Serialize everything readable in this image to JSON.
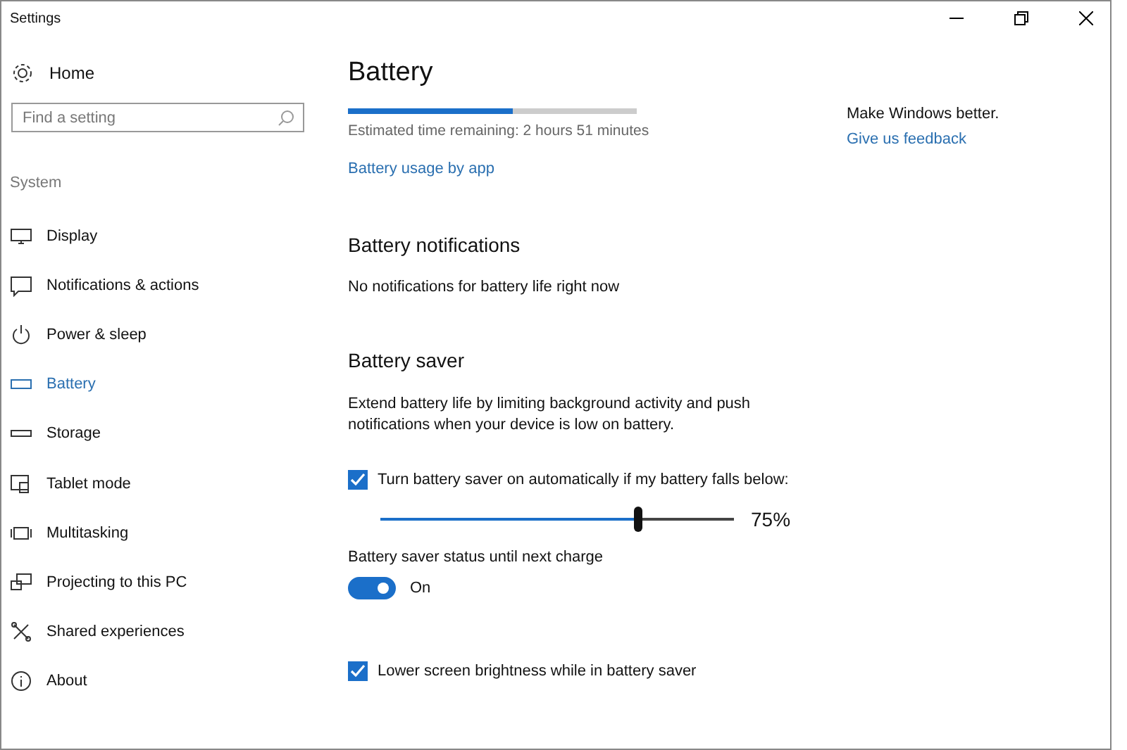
{
  "window": {
    "title": "Settings"
  },
  "sidebar": {
    "home": "Home",
    "search": {
      "placeholder": "Find a setting"
    },
    "section": "System",
    "items": [
      {
        "label": "Display",
        "selected": false
      },
      {
        "label": "Notifications & actions",
        "selected": false
      },
      {
        "label": "Power & sleep",
        "selected": false
      },
      {
        "label": "Battery",
        "selected": true
      },
      {
        "label": "Storage",
        "selected": false
      },
      {
        "label": "Tablet mode",
        "selected": false
      },
      {
        "label": "Multitasking",
        "selected": false
      },
      {
        "label": "Projecting to this PC",
        "selected": false
      },
      {
        "label": "Shared experiences",
        "selected": false
      },
      {
        "label": "About",
        "selected": false
      }
    ]
  },
  "page": {
    "title": "Battery",
    "charge": {
      "level": 0.57
    },
    "estimate": "Estimated time remaining: 2 hours 51 minutes",
    "usage_link": "Battery usage by app",
    "notifications": {
      "heading": "Battery notifications",
      "text": "No notifications for battery life right now"
    },
    "saver": {
      "heading": "Battery saver",
      "description": "Extend battery life by limiting background activity and push notifications when your device is low on battery.",
      "auto": {
        "label": "Turn battery saver on automatically if my battery falls below:",
        "checked": true
      },
      "threshold": {
        "level": 0.73,
        "reading": "75%"
      },
      "status": {
        "label": "Battery saver status until next charge",
        "on": true,
        "state_text": "On"
      },
      "brightness": {
        "label": "Lower screen brightness while in battery saver",
        "checked": true
      }
    }
  },
  "aside": {
    "text": "Make Windows better.",
    "link": "Give us feedback"
  }
}
